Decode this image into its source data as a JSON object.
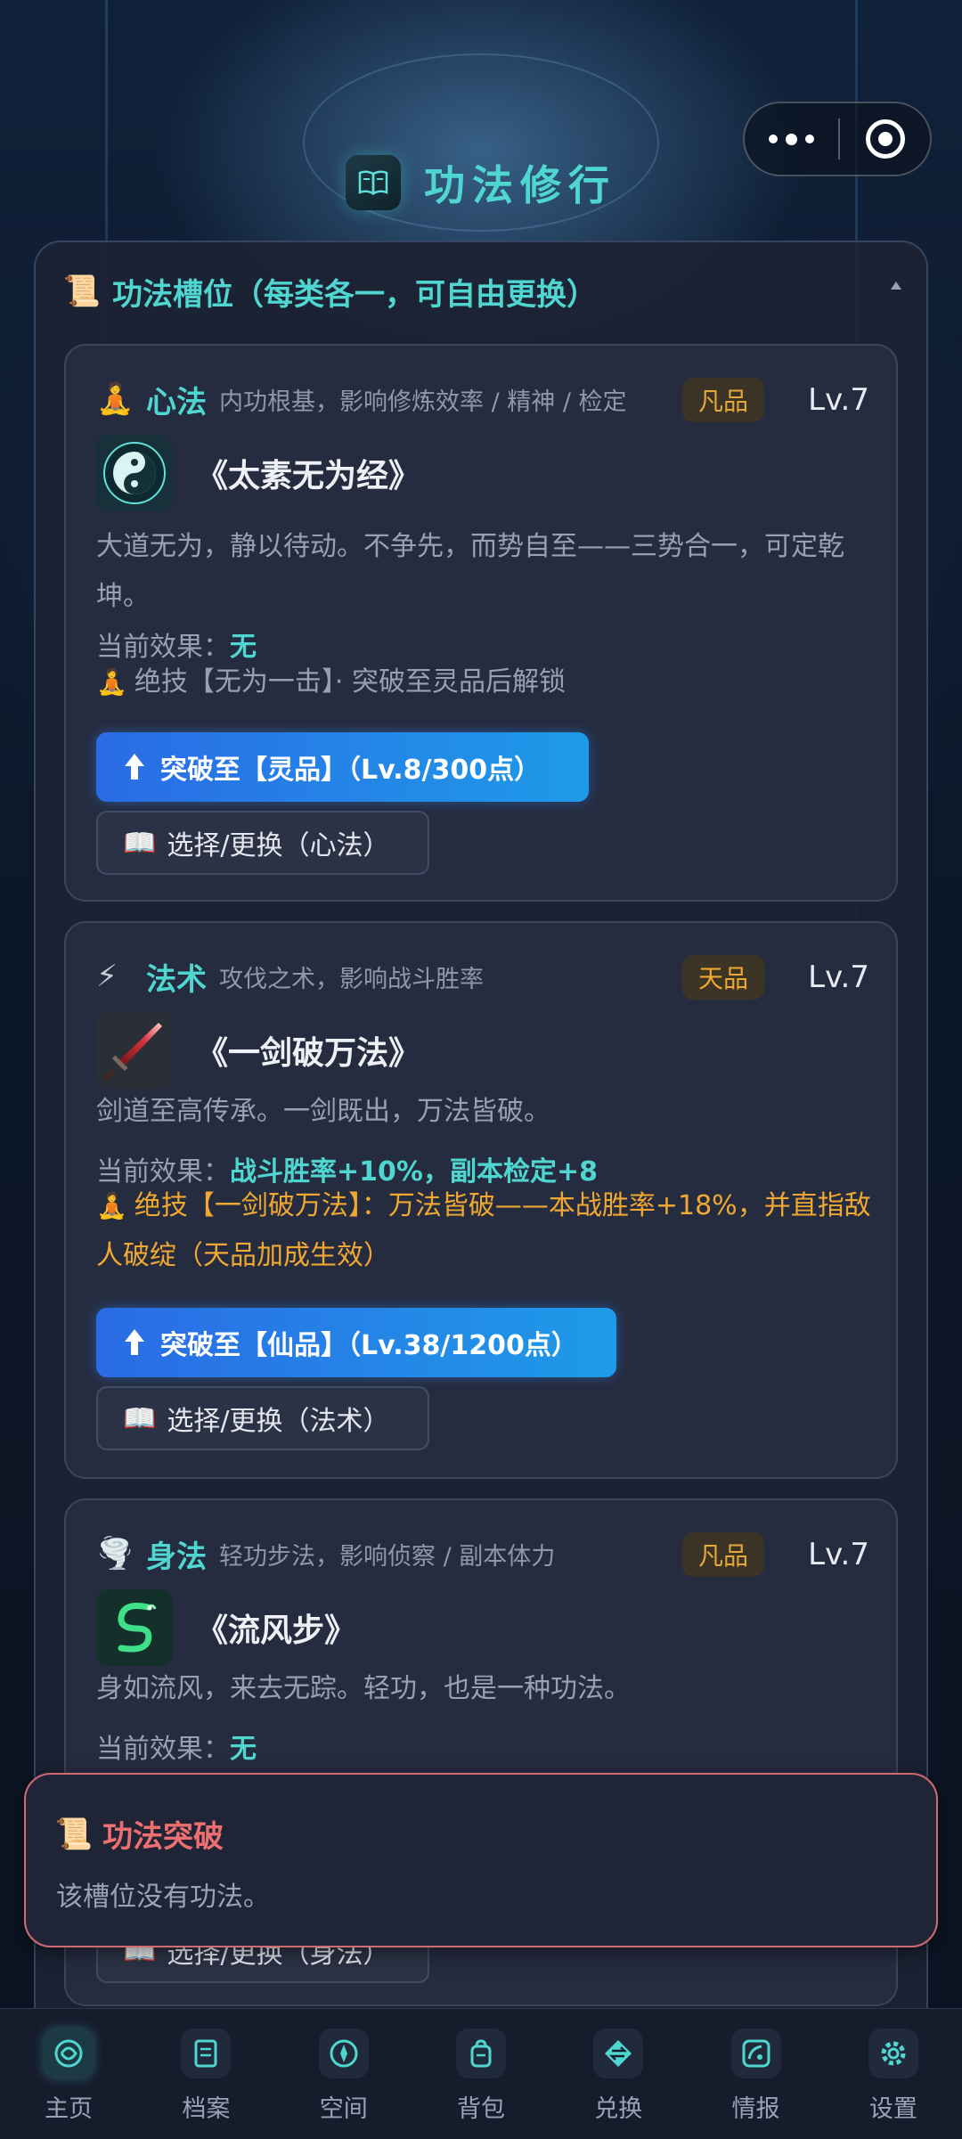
{
  "header": {
    "title": "功法修行",
    "icon": "open-book-icon"
  },
  "capsule": {
    "more_icon": "more-dots-icon",
    "close_icon": "target-circle-icon"
  },
  "panel": {
    "title": "功法槽位（每类各一，可自由更换）",
    "title_icon": "scroll-icon",
    "collapse_icon": "caret-up-icon"
  },
  "slots": [
    {
      "emoji": "🧘",
      "name": "心法",
      "desc": "内功根基，影响修炼效率 / 精神 / 检定",
      "grade": "凡品",
      "level": "Lv.7",
      "tech_icon": "taiji-icon",
      "tech_name": "《太素无为经》",
      "tech_desc": "大道无为，静以待动。不争先，而势自至——三势合一，可定乾坤。",
      "effect_label": "当前效果：",
      "effect_value": "无",
      "skill_emoji": "🧘",
      "skill_text": "绝技【无为一击】· 突破至灵品后解锁",
      "break_label": "突破至【灵品】（Lv.8/300点）",
      "select_label": "选择/更换（心法）"
    },
    {
      "emoji": "⚡",
      "name": "法术",
      "desc": "攻伐之术，影响战斗胜率",
      "grade": "天品",
      "level": "Lv.7",
      "tech_icon": "sword-icon",
      "tech_name": "《一剑破万法》",
      "tech_desc": "剑道至高传承。一剑既出，万法皆破。",
      "effect_label": "当前效果：",
      "effect_value": "战斗胜率+10%，副本检定+8",
      "skill_emoji": "🧘",
      "skill_text": "绝技【一剑破万法】：万法皆破——本战胜率+18%，并直指敌人破绽（天品加成生效）",
      "break_label": "突破至【仙品】（Lv.38/1200点）",
      "select_label": "选择/更换（法术）"
    },
    {
      "emoji": "🌪️",
      "name": "身法",
      "desc": "轻功步法，影响侦察 / 副本体力",
      "grade": "凡品",
      "level": "Lv.7",
      "tech_icon": "dragon-icon",
      "tech_name": "《流风步》",
      "tech_desc": "身如流风，来去无踪。轻功，也是一种功法。",
      "effect_label": "当前效果：",
      "effect_value": "无",
      "select_label": "选择/更换（身法）"
    }
  ],
  "toast": {
    "icon": "scroll-icon",
    "title": "功法突破",
    "message": "该槽位没有功法。"
  },
  "tabs": [
    {
      "label": "主页",
      "icon": "swirl-home-icon"
    },
    {
      "label": "档案",
      "icon": "document-icon"
    },
    {
      "label": "空间",
      "icon": "compass-icon"
    },
    {
      "label": "背包",
      "icon": "backpack-icon"
    },
    {
      "label": "兑换",
      "icon": "exchange-icon"
    },
    {
      "label": "情报",
      "icon": "radar-dish-icon"
    },
    {
      "label": "设置",
      "icon": "gear-icon"
    }
  ]
}
